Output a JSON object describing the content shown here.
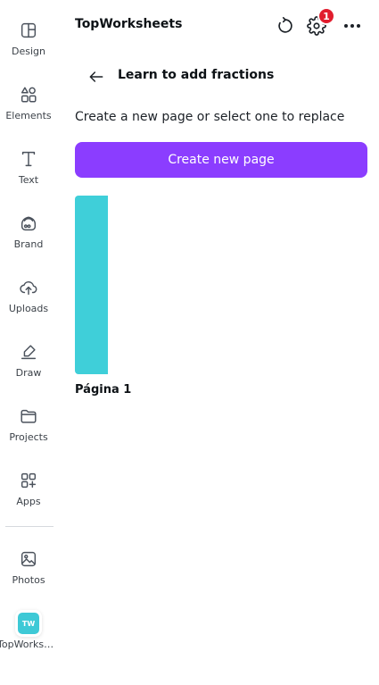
{
  "sidebar": {
    "items": [
      {
        "label": "Design",
        "icon": "layout-icon"
      },
      {
        "label": "Elements",
        "icon": "shapes-icon"
      },
      {
        "label": "Text",
        "icon": "text-icon"
      },
      {
        "label": "Brand",
        "icon": "brand-icon"
      },
      {
        "label": "Uploads",
        "icon": "cloud-upload-icon"
      },
      {
        "label": "Draw",
        "icon": "pen-icon"
      },
      {
        "label": "Projects",
        "icon": "folder-icon"
      },
      {
        "label": "Apps",
        "icon": "apps-icon"
      },
      {
        "label": "Photos",
        "icon": "image-icon"
      },
      {
        "label": "TopWorksheets",
        "icon": "topworksheets-app-icon",
        "badge_text": "TW"
      }
    ]
  },
  "header": {
    "title": "TopWorksheets",
    "notification_count": "1"
  },
  "panel": {
    "back_title": "Learn to add fractions",
    "instruction": "Create a new page or select one to replace",
    "create_button": "Create new page",
    "pages": [
      {
        "label": "Página 1"
      }
    ]
  },
  "colors": {
    "accent": "#8b3dff",
    "thumbnail": "#3fcfd9",
    "badge": "#e11d2e"
  }
}
